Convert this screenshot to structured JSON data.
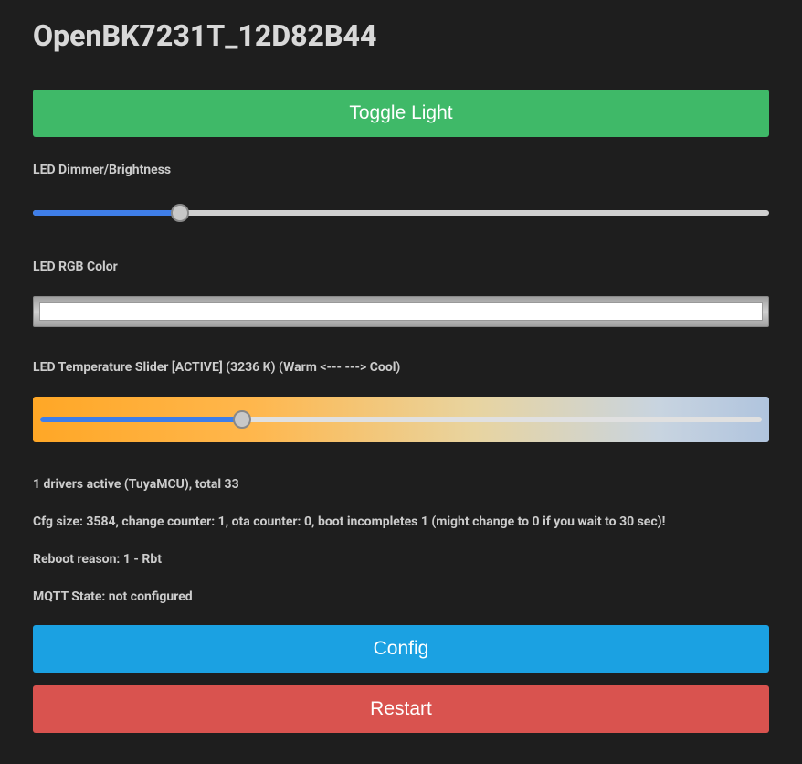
{
  "title": "OpenBK7231T_12D82B44",
  "buttons": {
    "toggle": "Toggle Light",
    "config": "Config",
    "restart": "Restart"
  },
  "sliders": {
    "brightness": {
      "label": "LED Dimmer/Brightness",
      "value": 20,
      "max": 100
    },
    "rgb": {
      "label": "LED RGB Color",
      "value": "#ffffff"
    },
    "temperature": {
      "label": "LED Temperature Slider [ACTIVE] (3236 K) (Warm <--- ---> Cool)",
      "value": 28,
      "max": 100,
      "kelvin": 3236
    }
  },
  "status": {
    "drivers": "1 drivers active (TuyaMCU), total 33",
    "cfg": "Cfg size: 3584, change counter: 1, ota counter: 0, boot incompletes 1 (might change to 0 if you wait to 30 sec)!",
    "reboot": "Reboot reason: 1 - Rbt",
    "mqtt": "MQTT State: not configured"
  }
}
